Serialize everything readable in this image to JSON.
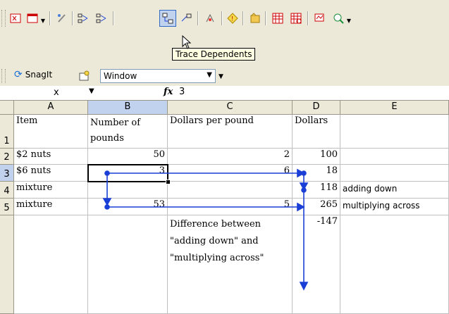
{
  "toolbar": {
    "icons": [
      "show-formulas-icon",
      "chart-icon",
      "dropdown-icon",
      "trace-precedents-icon",
      "remove-precedent-arrows-icon",
      "trace-dependents-icon",
      "remove-dependent-arrows-icon",
      "remove-all-arrows-icon",
      "trace-error-icon",
      "new-comment-icon",
      "circle-invalid-data-icon",
      "clear-validation-circles-icon",
      "watch-window-icon",
      "evaluate-formula-icon"
    ],
    "tooltip": "Trace Dependents",
    "snagit_label": "SnagIt",
    "window_combo_value": "Window"
  },
  "formula_bar": {
    "name_box": "x",
    "fx_label": "fx",
    "value": "3"
  },
  "columns": [
    "A",
    "B",
    "C",
    "D",
    "E"
  ],
  "rows": [
    "1",
    "2",
    "3",
    "4",
    "5",
    ""
  ],
  "cells": {
    "a1": "Item",
    "b1_line1": "Number of",
    "b1_line2": "pounds",
    "c1": "Dollars per pound",
    "d1": "Dollars",
    "a2": "$2 nuts",
    "b2": "50",
    "c2": "2",
    "d2": "100",
    "a3": "$6 nuts",
    "b3": "3",
    "c3": "6",
    "d3": "18",
    "a4": "mixture",
    "d4": "118",
    "e4": "adding down",
    "a5": "mixture",
    "b5": "53",
    "c5": "5",
    "d5": "265",
    "e5": "multiplying across",
    "c6_line1": "Difference between",
    "c6_line2": "\"adding down\" and",
    "c6_line3": "\"multiplying across\"",
    "d6": "-147"
  },
  "colors": {
    "arrow": "#1a3fd6",
    "header_bg": "#ece9d8",
    "header_selected": "#c1d2ee"
  }
}
